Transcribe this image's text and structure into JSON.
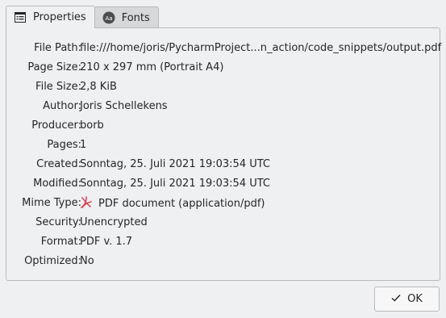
{
  "tabs": [
    {
      "label": "Properties",
      "icon": "document-properties-icon"
    },
    {
      "label": "Fonts",
      "icon": "fonts-icon"
    }
  ],
  "properties": [
    {
      "label": "File Path:",
      "value": "file:///home/joris/PycharmProject...n_action/code_snippets/output.pdf"
    },
    {
      "label": "Page Size:",
      "value": "210 x 297 mm (Portrait A4)"
    },
    {
      "label": "File Size:",
      "value": "2,8 KiB"
    },
    {
      "label": "Author:",
      "value": "Joris Schellekens"
    },
    {
      "label": "Producer:",
      "value": "borb"
    },
    {
      "label": "Pages:",
      "value": "1"
    },
    {
      "label": "Created:",
      "value": "Sonntag, 25. Juli 2021 19:03:54 UTC"
    },
    {
      "label": "Modified:",
      "value": "Sonntag, 25. Juli 2021 19:03:54 UTC"
    },
    {
      "label": "Mime Type:",
      "value": "PDF document (application/pdf)",
      "icon": "pdf-icon"
    },
    {
      "label": "Security:",
      "value": "Unencrypted"
    },
    {
      "label": "Format:",
      "value": "PDF v. 1.7"
    },
    {
      "label": "Optimized:",
      "value": "No"
    }
  ],
  "buttons": {
    "ok_label": "OK"
  },
  "colors": {
    "pdf_icon": "#da4453",
    "border": "#b7b9bb",
    "background": "#eff0f1"
  }
}
